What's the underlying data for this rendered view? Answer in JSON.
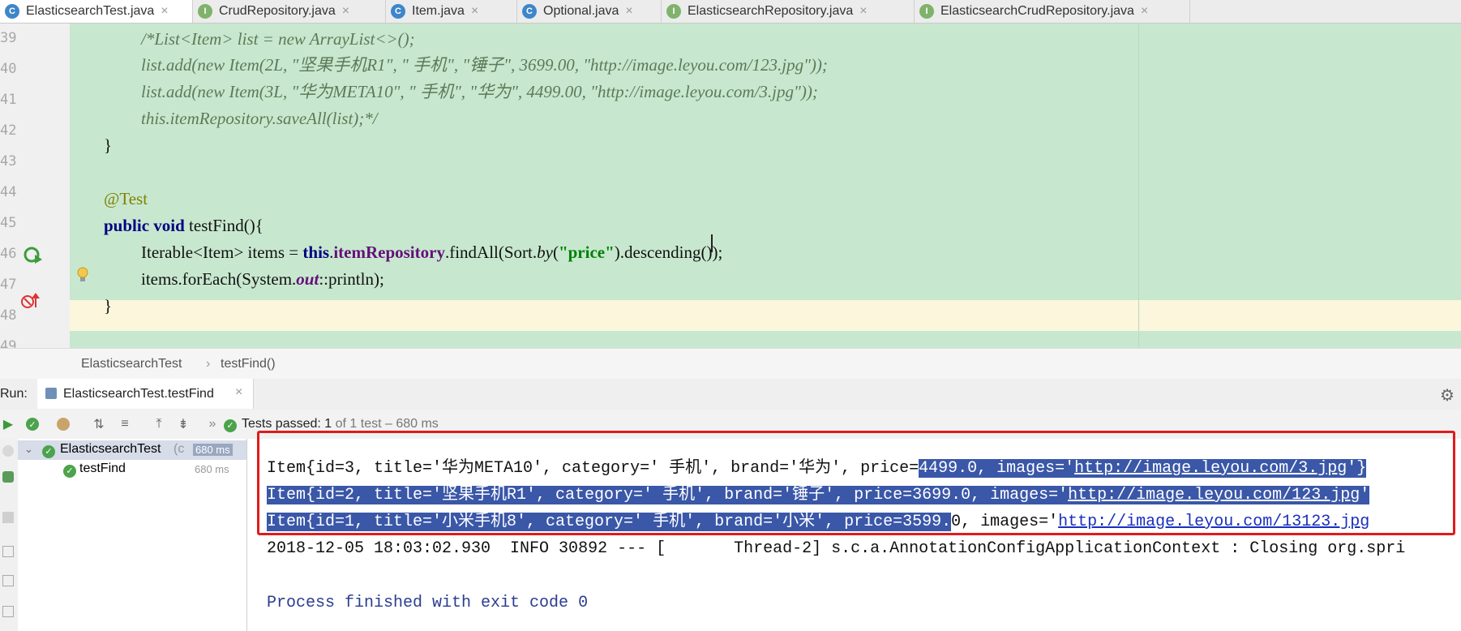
{
  "tabs": [
    {
      "label": "ElasticsearchTest.java",
      "icon": "class-icon",
      "active": true
    },
    {
      "label": "CrudRepository.java",
      "icon": "interface-icon"
    },
    {
      "label": "Item.java",
      "icon": "class-icon"
    },
    {
      "label": "Optional.java",
      "icon": "class-icon"
    },
    {
      "label": "ElasticsearchRepository.java",
      "icon": "interface-icon"
    },
    {
      "label": "ElasticsearchCrudRepository.java",
      "icon": "interface-icon"
    }
  ],
  "editor": {
    "line_numbers": [
      "39",
      "40",
      "41",
      "42",
      "43",
      "44",
      "45",
      "46",
      "47",
      "48",
      "49"
    ],
    "code": {
      "l39": "/*List<Item> list = new ArrayList<>();",
      "l40": "list.add(new Item(2L, \"坚果手机R1\", \" 手机\", \"锤子\", 3699.00, \"http://image.leyou.com/123.jpg\"));",
      "l41": "list.add(new Item(3L, \"华为META10\", \" 手机\", \"华为\", 4499.00, \"http://image.leyou.com/3.jpg\"));",
      "l42": "this.itemRepository.saveAll(list);*/",
      "l43": "}",
      "l45": "@Test",
      "l46_kw": "public void",
      "l46_rest": " testFind(){",
      "l47_a": "Iterable<Item> items = ",
      "l47_this": "this",
      "l47_dot": ".",
      "l47_field": "itemRepository",
      "l47_b": ".findAll(Sort.",
      "l47_by": "by",
      "l47_c": "(",
      "l47_str": "\"price\"",
      "l47_d": ").descending());",
      "l48_a": "items.forEach(System.",
      "l48_out": "out",
      "l48_b": "::println);",
      "l49": "}"
    }
  },
  "breadcrumb": {
    "class": "ElasticsearchTest",
    "separator": "›",
    "method": "testFind()"
  },
  "run": {
    "label": "Run:",
    "tab_label": "ElasticsearchTest.testFind",
    "status_bold": "Tests passed: 1",
    "status_rest": " of 1 test – 680 ms",
    "tree": [
      {
        "name": "ElasticsearchTest",
        "suffix": "(c",
        "time": "680 ms"
      },
      {
        "name": "testFind",
        "time": "680 ms"
      }
    ]
  },
  "console": {
    "line1_pre": "Item{id=3, title='华为META10', category=' 手机', brand='华为', price=",
    "line1_sel": "4499.0, images='",
    "line1_link": "http://image.leyou.com/3.jpg",
    "line1_post": "'}",
    "line2_pre": "Item{id=2, title='坚果手机R1', category=' 手机', brand='锤子', price=3699.0, images='",
    "line2_link": "http://image.leyou.com/123.jpg",
    "line2_post": "'",
    "line3_sel": "Item{id=1, title='小米手机8', category=' 手机', brand='小米', price=3599.",
    "line3_rest": "0, images='",
    "line3_link": "http://image.leyou.com/13123.jpg",
    "line4": "2018-12-05 18:03:02.930  INFO 30892 --- [       Thread-2] s.c.a.AnnotationConfigApplicationContext : Closing org.spri",
    "line5": "Process finished with exit code 0"
  },
  "colors": {
    "selection": "#3a57a8",
    "highlight_box": "#e01b1b",
    "editor_bg": "#c7e8cf",
    "pass": "#4ca34c"
  }
}
